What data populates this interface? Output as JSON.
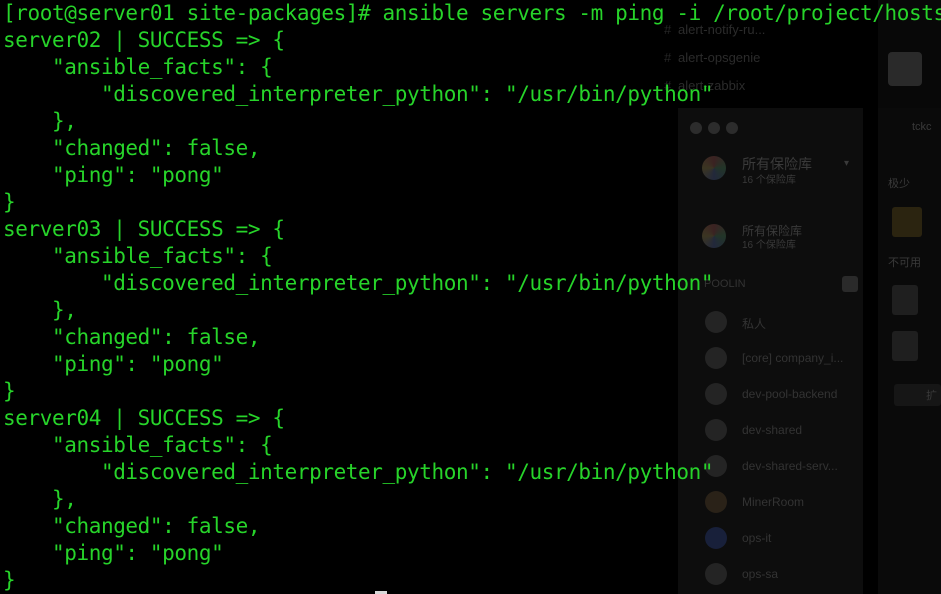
{
  "terminal": {
    "prompt_line": "[root@server01 site-packages]# ansible servers -m ping -i /root/project/hosts",
    "lines": [
      "server02 | SUCCESS => {",
      "    \"ansible_facts\": {",
      "        \"discovered_interpreter_python\": \"/usr/bin/python\"",
      "    },",
      "    \"changed\": false,",
      "    \"ping\": \"pong\"",
      "}",
      "server03 | SUCCESS => {",
      "    \"ansible_facts\": {",
      "        \"discovered_interpreter_python\": \"/usr/bin/python\"",
      "    },",
      "    \"changed\": false,",
      "    \"ping\": \"pong\"",
      "}",
      "server04 | SUCCESS => {",
      "    \"ansible_facts\": {",
      "        \"discovered_interpreter_python\": \"/usr/bin/python\"",
      "    },",
      "    \"changed\": false,",
      "    \"ping\": \"pong\"",
      "}"
    ],
    "text_color": "#27d42a",
    "background_color": "#000000"
  },
  "background_window": {
    "channels": [
      "alert-notify-ru...",
      "alert-opsgenie",
      "alert-zabbix"
    ],
    "vault_selector": {
      "title": "所有保险库",
      "subtitle": "16 个保险库"
    },
    "vault_item": {
      "title": "所有保险库",
      "subtitle": "16 个保险库"
    },
    "section_label": "POOLIN",
    "members": [
      "私人",
      "[core] company_i...",
      "dev-pool-backend",
      "dev-shared",
      "dev-shared-serv...",
      "MinerRoom",
      "ops-it",
      "ops-sa"
    ],
    "right_panel": {
      "header": "tckc",
      "label_few": "极少",
      "label_unavailable": "不可用",
      "button": "扩"
    }
  }
}
